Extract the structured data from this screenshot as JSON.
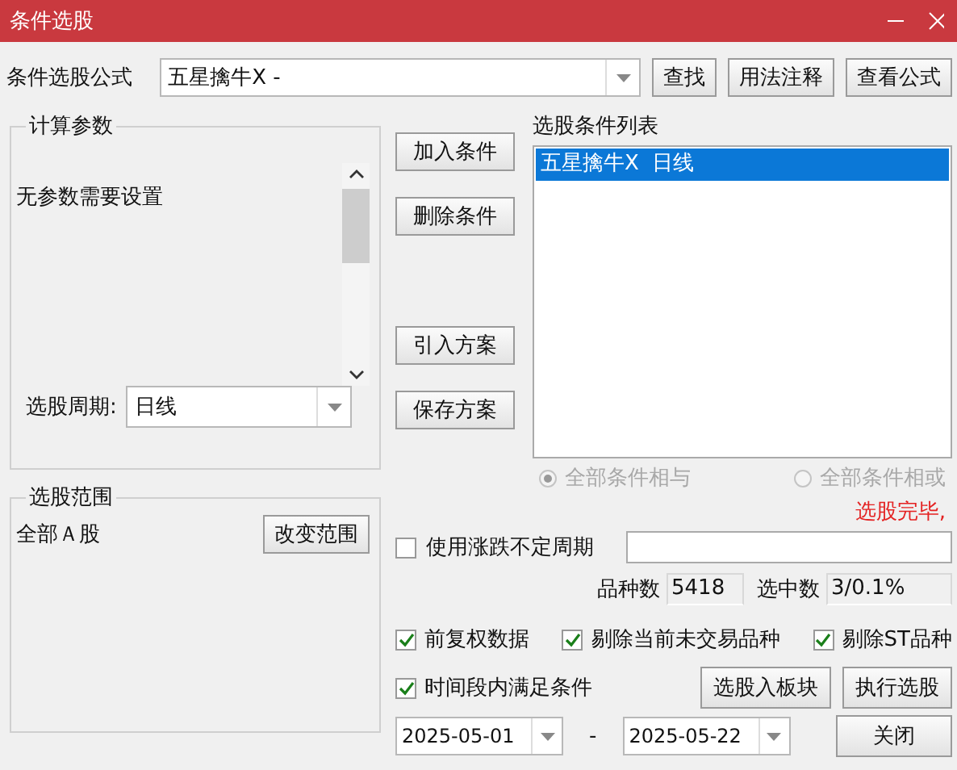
{
  "window": {
    "title": "条件选股"
  },
  "formula": {
    "label": "条件选股公式",
    "value": "五星擒牛X  -"
  },
  "top_buttons": [
    "查找",
    "用法注释",
    "查看公式"
  ],
  "params": {
    "title": "计算参数",
    "message": "无参数需要设置",
    "period_label": "选股周期:",
    "period_value": "日线"
  },
  "scope": {
    "title": "选股范围",
    "value": "全部Ａ股",
    "button": "改变范围"
  },
  "middle_buttons": [
    "加入条件",
    "删除条件",
    "引入方案",
    "保存方案"
  ],
  "conditions": {
    "title": "选股条件列表",
    "items": [
      {
        "text": "五星擒牛X  日线",
        "selected": true
      }
    ]
  },
  "logic": [
    {
      "label": "全部条件相与",
      "selected": true,
      "disabled": true
    },
    {
      "label": "全部条件相或",
      "selected": false,
      "disabled": true
    }
  ],
  "status": "选股完毕,",
  "variable_period": {
    "label": "使用涨跌不定周期",
    "checked": false
  },
  "counts": [
    {
      "label": "品种数",
      "value": "5418"
    },
    {
      "label": "选中数",
      "value": "3/0.1%"
    }
  ],
  "options": [
    {
      "label": "前复权数据",
      "checked": true
    },
    {
      "label": "剔除当前未交易品种",
      "checked": true
    },
    {
      "label": "剔除ST品种",
      "checked": true
    }
  ],
  "time_range": {
    "label": "时间段内满足条件",
    "checked": true
  },
  "dates": {
    "start": "2025-05-01",
    "separator": "-",
    "end": "2025-05-22"
  },
  "action_buttons": [
    "选股入板块",
    "执行选股",
    "关闭"
  ]
}
